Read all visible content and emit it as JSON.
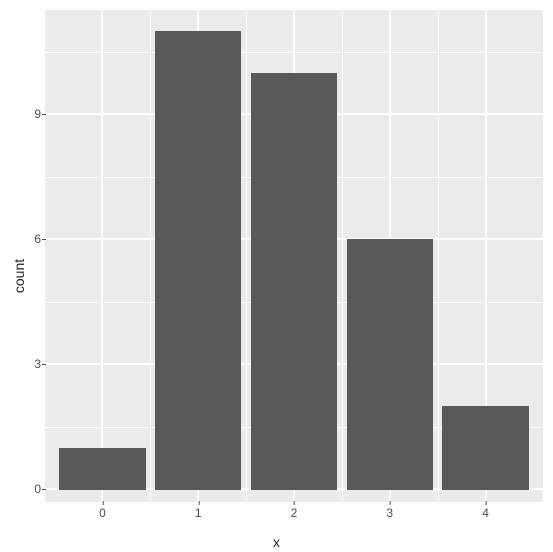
{
  "chart_data": {
    "type": "bar",
    "categories": [
      0,
      1,
      2,
      3,
      4
    ],
    "values": [
      1,
      11,
      10,
      6,
      2
    ],
    "xlabel": "x",
    "ylabel": "count",
    "ylim": [
      0,
      11.5
    ],
    "yticks": [
      0,
      3,
      6,
      9
    ],
    "xticks": [
      0,
      1,
      2,
      3,
      4
    ],
    "bar_fill": "#595959",
    "panel_bg": "#ebebeb"
  }
}
